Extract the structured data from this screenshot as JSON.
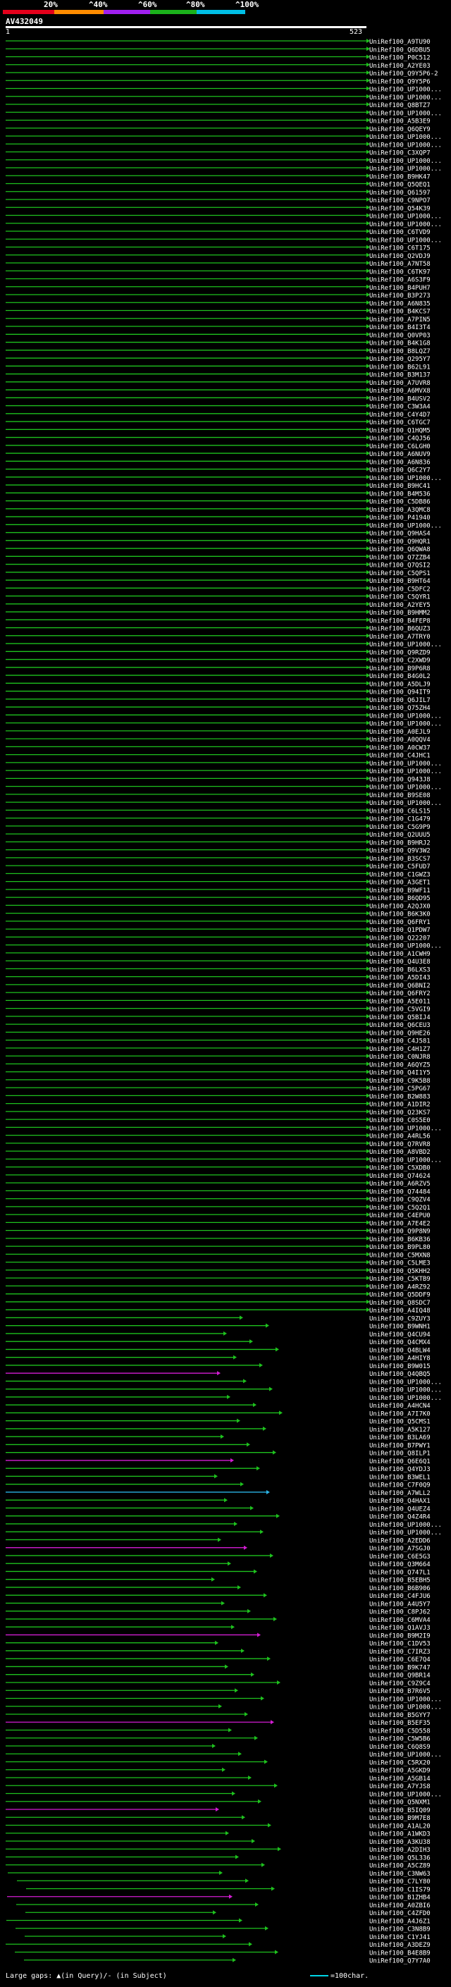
{
  "scale": {
    "labels": [
      "20%",
      "^40%",
      "^60%",
      "^80%",
      "^100%"
    ],
    "colors": [
      "#e4001b",
      "#ff8c00",
      "#a020f0",
      "#1bb11b",
      "#00bfe6"
    ]
  },
  "query": {
    "title": "AV432049",
    "start": "1",
    "end": "523"
  },
  "colors": {
    "green": "#1ec11e",
    "magenta": "#d21dd2",
    "cyan": "#2ab4e6",
    "gap": "#ffffff"
  },
  "chart_data": {
    "type": "alignment-overview",
    "query_length": 523,
    "hits": [
      "UniRef100_A9TU90",
      "UniRef100_Q6DBU5",
      "UniRef100_P0C512",
      "UniRef100_A2YE03",
      "UniRef100_Q9Y5P6-2",
      "UniRef100_Q9Y5P6",
      "UniRef100_UP1000...",
      "UniRef100_UP1000...",
      "UniRef100_Q8BTZ7",
      "UniRef100_UP1000...",
      "UniRef100_A5B3E9",
      "UniRef100_Q6QEY9",
      "UniRef100_UP1000...",
      "UniRef100_UP1000...",
      "UniRef100_C3XQP7",
      "UniRef100_UP1000...",
      "UniRef100_UP1000...",
      "UniRef100_B9HK47",
      "UniRef100_Q5QEQ1",
      "UniRef100_Q61597",
      "UniRef100_C9NPO7",
      "UniRef100_Q54K39",
      "UniRef100_UP1000...",
      "UniRef100_UP1000...",
      "UniRef100_C6TVD9",
      "UniRef100_UP1000...",
      "UniRef100_C6T175",
      "UniRef100_Q2VDJ9",
      "UniRef100_A7NT58",
      "UniRef100_C6TK97",
      "UniRef100_A6S3F9",
      "UniRef100_B4PUH7",
      "UniRef100_B3P273",
      "UniRef100_A6N835",
      "UniRef100_B4KCS7",
      "UniRef100_A7PIN5",
      "UniRef100_B4I3T4",
      "UniRef100_Q0VP03",
      "UniRef100_B4K1G8",
      "UniRef100_B8LQZ7",
      "UniRef100_Q295Y7",
      "UniRef100_B62L91",
      "UniRef100_B3M137",
      "UniRef100_A7UVR8",
      "UniRef100_A6MVX8",
      "UniRef100_B4USV2",
      "UniRef100_C3W3A4",
      "UniRef100_C4Y4D7",
      "UniRef100_C6TGC7",
      "UniRef100_Q1HQM5",
      "UniRef100_C4QJ56",
      "UniRef100_C6LGH0",
      "UniRef100_A6NUV9",
      "UniRef100_A6N836",
      "UniRef100_Q6C2Y7",
      "UniRef100_UP1000...",
      "UniRef100_B9HC41",
      "UniRef100_B4M536",
      "UniRef100_C5DB86",
      "UniRef100_A3QMC8",
      "UniRef100_P41940",
      "UniRef100_UP1000...",
      "UniRef100_Q9HAS4",
      "UniRef100_Q9HQR1",
      "UniRef100_Q6QWA8",
      "UniRef100_Q7ZZB4",
      "UniRef100_Q7QSI2",
      "UniRef100_C5QPS1",
      "UniRef100_B9HT64",
      "UniRef100_C5DFC2",
      "UniRef100_C5QYR1",
      "UniRef100_A2YEY5",
      "UniRef100_B9HMM2",
      "UniRef100_B4FEP8",
      "UniRef100_B6QUZ3",
      "UniRef100_A7TRY0",
      "UniRef100_UP1000...",
      "UniRef100_Q9RZD9",
      "UniRef100_C2XWD9",
      "UniRef100_B9P6R8",
      "UniRef100_B4G0L2",
      "UniRef100_A5DLJ9",
      "UniRef100_Q94IT9",
      "UniRef100_Q6JIL7",
      "UniRef100_Q75ZH4",
      "UniRef100_UP1000...",
      "UniRef100_UP1000...",
      "UniRef100_A0EJL9",
      "UniRef100_A0QQV4",
      "UniRef100_A0CW37",
      "UniRef100_C4JHC1",
      "UniRef100_UP1000...",
      "UniRef100_UP1000...",
      "UniRef100_Q943J8",
      "UniRef100_UP1000...",
      "UniRef100_B9SE08",
      "UniRef100_UP1000...",
      "UniRef100_C6LS15",
      "UniRef100_C1G479",
      "UniRef100_C5G9P9",
      "UniRef100_Q2UUU5",
      "UniRef100_B9HRJ2",
      "UniRef100_Q9V3W2",
      "UniRef100_B3SCS7",
      "UniRef100_C5FUD7",
      "UniRef100_C1GWZ3",
      "UniRef100_A3GET1",
      "UniRef100_B9WF11",
      "UniRef100_B6QD95",
      "UniRef100_A2QJX0",
      "UniRef100_B6K3K0",
      "UniRef100_Q6FRY1",
      "UniRef100_Q1PDW7",
      "UniRef100_Q22207",
      "UniRef100_UP1000...",
      "UniRef100_A1CWH9",
      "UniRef100_Q4U3E8",
      "UniRef100_B6LXS3",
      "UniRef100_A5DI43",
      "UniRef100_Q6BNI2",
      "UniRef100_Q6FRY2",
      "UniRef100_A5E011",
      "UniRef100_C5VGI9",
      "UniRef100_Q5BIJ4",
      "UniRef100_Q6CEU3",
      "UniRef100_Q9HE26",
      "UniRef100_C4J581",
      "UniRef100_C4H1Z7",
      "UniRef100_C0NJR8",
      "UniRef100_A6QYZ5",
      "UniRef100_Q4I1Y5",
      "UniRef100_C9K5B8",
      "UniRef100_C5PG67",
      "UniRef100_B2W883",
      "UniRef100_A1DIR2",
      "UniRef100_Q23KS7",
      "UniRef100_C0S5E0",
      "UniRef100_UP1000...",
      "UniRef100_A4RL56",
      "UniRef100_Q7RVR8",
      "UniRef100_A8VBD2",
      "UniRef100_UP1000...",
      "UniRef100_C5XDB0",
      "UniRef100_Q74624",
      "UniRef100_A6RZV5",
      "UniRef100_Q74484",
      "UniRef100_C9QZV4",
      "UniRef100_C5Q2Q1",
      "UniRef100_C4EPU0",
      "UniRef100_A7E4E2",
      "UniRef100_Q9P8N9",
      "UniRef100_B6KB36",
      "UniRef100_B9PL80",
      "UniRef100_C5MXN8",
      "UniRef100_C5LME3",
      "UniRef100_Q5KHH2",
      "UniRef100_C5KTB9",
      "UniRef100_A4RZ92",
      "UniRef100_Q5DDF9",
      "UniRef100_Q8SDC7",
      "UniRef100_A4IQ48",
      "UniRef100_C9ZUY3",
      "UniRef100_B9WNH1",
      "UniRef100_Q4CU94",
      "UniRef100_Q4CMX4",
      "UniRef100_Q4BLW4",
      "UniRef100_A4HIY8",
      "UniRef100_B9W015",
      "UniRef100_Q4QBQ5",
      "UniRef100_UP1000...",
      "UniRef100_UP1000...",
      "UniRef100_UP1000...",
      "UniRef100_A4HCN4",
      "UniRef100_A7I7K0",
      "UniRef100_Q5CMS1",
      "UniRef100_A5K127",
      "UniRef100_B3LA69",
      "UniRef100_B7PWY1",
      "UniRef100_Q8ILP1",
      "UniRef100_Q6E6Q1",
      "UniRef100_Q4YDJ3",
      "UniRef100_B3WEL1",
      "UniRef100_C7F0Q9",
      "UniRef100_A7WLL2",
      "UniRef100_Q4HAX1",
      "UniRef100_Q4UEZ4",
      "UniRef100_Q4Z4R4",
      "UniRef100_UP1000...",
      "UniRef100_UP1000...",
      "UniRef100_A2EDD6",
      "UniRef100_A7SGJ0",
      "UniRef100_C6E5G3",
      "UniRef100_Q3M664",
      "UniRef100_Q747L1",
      "UniRef100_B5EBH5",
      "UniRef100_B6B906",
      "UniRef100_C4FJU6",
      "UniRef100_A4U5Y7",
      "UniRef100_C8PJ62",
      "UniRef100_C6MVA4",
      "UniRef100_Q1AVJ3",
      "UniRef100_B9M2I9",
      "UniRef100_C1DV53",
      "UniRef100_C7IRZ3",
      "UniRef100_C6E7Q4",
      "UniRef100_B9K747",
      "UniRef100_Q9BR14",
      "UniRef100_C9Z9C4",
      "UniRef100_B7R6V5",
      "UniRef100_UP1000...",
      "UniRef100_UP1000...",
      "UniRef100_B5GYY7",
      "UniRef100_B5EF35",
      "UniRef100_C5D558",
      "UniRef100_C5W5B6",
      "UniRef100_C6Q8S9",
      "UniRef100_UP1000...",
      "UniRef100_C5RX20",
      "UniRef100_A5GKD9",
      "UniRef100_A5GB14",
      "UniRef100_A7YJS8",
      "UniRef100_UP1000...",
      "UniRef100_Q5NXM1",
      "UniRef100_B5IQ09",
      "UniRef100_B9M7E8",
      "UniRef100_A1AL20",
      "UniRef100_A1WKD3",
      "UniRef100_A3KU38",
      "UniRef100_A2DIH3",
      "UniRef100_Q5L336",
      "UniRef100_A5CZ89",
      "UniRef100_C3NW63",
      "UniRef100_C7LY80",
      "UniRef100_C1IS79",
      "UniRef100_B1ZHB4",
      "UniRef100_A0ZBI6",
      "UniRef100_C4ZFD0",
      "UniRef100_A4J6Z1",
      "UniRef100_C3N8B9",
      "UniRef100_C1YJ41",
      "UniRef100_A3DEZ9",
      "UniRef100_B4E8B9",
      "UniRef100_Q7Y7A0"
    ]
  },
  "footer": {
    "left": "Large gaps: ▲(in Query)/- (in Subject)",
    "right": "=100char."
  }
}
